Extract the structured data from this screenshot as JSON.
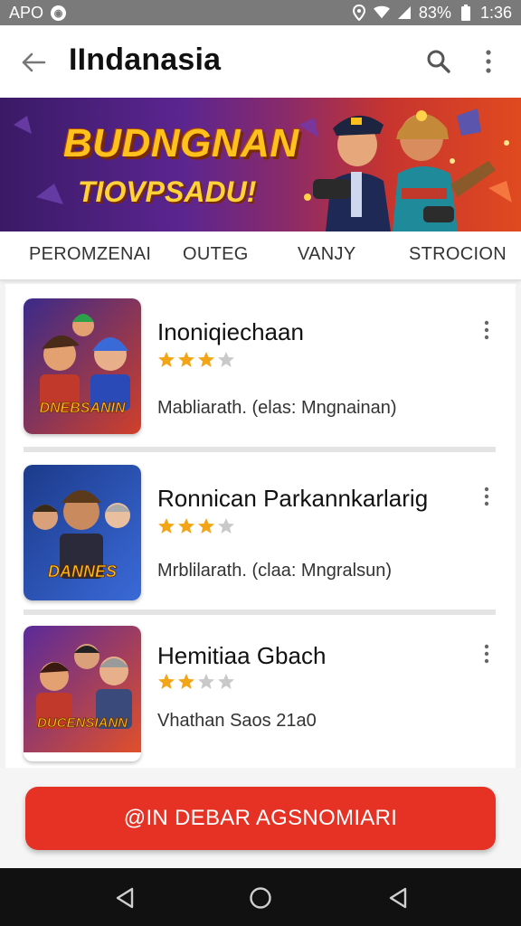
{
  "status_bar": {
    "carrier": "APO",
    "battery": "83%",
    "time": "1:36"
  },
  "app_bar": {
    "title": "IIndanasia",
    "back_icon": "arrow-back-icon",
    "search_icon": "search-icon",
    "more_icon": "more-vert-icon"
  },
  "banner": {
    "headline": "BUDNGNAN",
    "subheadline": "TIOVPSADU!"
  },
  "tabs": [
    {
      "label": "PEROMZENAI"
    },
    {
      "label": "OUTEG"
    },
    {
      "label": "VANJY"
    },
    {
      "label": "STROCION"
    }
  ],
  "games": [
    {
      "name": "Inoniqiechaan",
      "rating": 3,
      "subtitle": "Mabliarath. (elas: Mngnainan)",
      "thumb_caption": "DNEBSANIN"
    },
    {
      "name": "Ronnican Parkannkarlarig",
      "rating": 3,
      "subtitle": "Mrblilarath. (claa: Mngralsun)",
      "thumb_caption": "DANNES"
    },
    {
      "name": "Hemitiaa Gbach",
      "rating": 2,
      "subtitle": "Vhathan Saos 21a0",
      "thumb_caption": "DUCENSIANN"
    }
  ],
  "cta": {
    "label": "@IN DEBAR AGSNOMIARI"
  },
  "colors": {
    "accent": "#e53225",
    "star": "#f2a516",
    "star_empty": "#c9c9c9"
  }
}
